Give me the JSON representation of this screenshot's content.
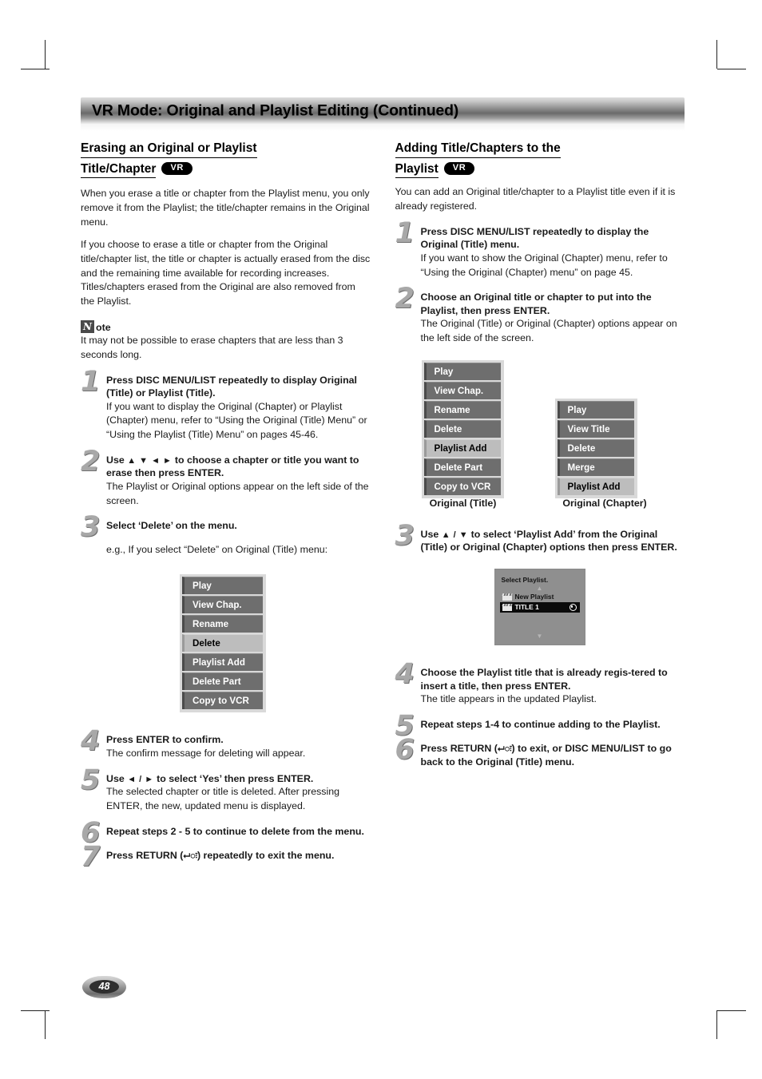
{
  "header": {
    "title": "VR Mode: Original and Playlist Editing (Continued)"
  },
  "page_number": "48",
  "left_column": {
    "heading_line1": "Erasing an Original or Playlist",
    "heading_line2": "Title/Chapter",
    "badge": "VR",
    "intro_paragraph_1": "When you erase a title or chapter from the Playlist menu, you only remove it from the Playlist; the title/chapter remains in the Original menu.",
    "intro_paragraph_2": "If you choose to erase a title or chapter from the Original title/chapter list, the title or chapter is actually erased from the disc and the remaining time available for recording increases. Titles/chapters erased from the Original are also removed from the Playlist.",
    "note": {
      "icon_letter": "N",
      "label": "ote",
      "text": "It may not be possible to erase chapters that are less than 3 seconds long."
    },
    "steps": [
      {
        "number": "1",
        "title": "Press DISC MENU/LIST repeatedly to display Original (Title) or Playlist (Title).",
        "desc": "If you want to display the Original (Chapter) or Playlist (Chapter) menu, refer to “Using the Original (Title) Menu” or “Using the Playlist (Title) Menu” on pages 45-46."
      },
      {
        "number": "2",
        "title_prefix": "Use ",
        "title_arrows": "▲ ▼ ◄ ►",
        "title_suffix": " to choose a chapter or title you want to erase then press ENTER.",
        "desc": "The Playlist or Original options appear on the left side of the screen."
      },
      {
        "number": "3",
        "title": "Select ‘Delete’ on the menu.",
        "desc": "e.g., If you select “Delete” on Original (Title) menu:"
      },
      {
        "number": "4",
        "title": "Press ENTER to confirm.",
        "desc": "The confirm message for deleting will appear."
      },
      {
        "number": "5",
        "title_prefix": "Use ",
        "title_arrows": "◄ / ►",
        "title_suffix": " to select ‘Yes’ then press ENTER.",
        "desc": "The selected chapter or title is deleted. After pressing ENTER, the new, updated menu is displayed."
      },
      {
        "number": "6",
        "title": "Repeat steps 2 - 5 to continue to delete from the menu.",
        "desc": ""
      },
      {
        "number": "7",
        "title_prefix": "Press RETURN (",
        "title_symbol": "⮠ः",
        "title_suffix": ") repeatedly to exit the menu.",
        "desc": ""
      }
    ],
    "osd_menu": {
      "name": "original-title-menu",
      "items": [
        {
          "label": "Play",
          "selected": false
        },
        {
          "label": "View Chap.",
          "selected": false
        },
        {
          "label": "Rename",
          "selected": false
        },
        {
          "label": "Delete",
          "selected": true
        },
        {
          "label": "Playlist Add",
          "selected": false
        },
        {
          "label": "Delete Part",
          "selected": false
        },
        {
          "label": "Copy to VCR",
          "selected": false
        }
      ]
    }
  },
  "right_column": {
    "heading_line1": "Adding Title/Chapters to the",
    "heading_line2": "Playlist",
    "badge": "VR",
    "intro_paragraph_1": "You can add an Original title/chapter to a Playlist title even if it is already registered.",
    "steps": [
      {
        "number": "1",
        "title": "Press DISC MENU/LIST repeatedly to display the Original (Title) menu.",
        "desc": "If you want to show the Original (Chapter) menu, refer to “Using the Original (Chapter) menu” on page 45."
      },
      {
        "number": "2",
        "title": "Choose an Original title or chapter to put into the Playlist, then press ENTER.",
        "desc": "The Original (Title) or Original (Chapter) options appear on the left side of the screen."
      },
      {
        "number": "3",
        "title_prefix": "Use ",
        "title_arrows": "▲ / ▼",
        "title_suffix": " to select ‘Playlist Add’ from the Original (Title) or Original (Chapter) options then press ENTER.",
        "desc": ""
      },
      {
        "number": "4",
        "title": "Choose the Playlist title that is already regis-tered to insert a title, then press ENTER.",
        "desc": "The title appears in the updated Playlist."
      },
      {
        "number": "5",
        "title": "Repeat steps 1-4 to continue adding to the Playlist.",
        "desc": ""
      },
      {
        "number": "6",
        "title_prefix": "Press RETURN (",
        "title_symbol": "⮠ः",
        "title_suffix": ") to exit, or DISC MENU/LIST to go back to the Original (Title) menu.",
        "desc": ""
      }
    ],
    "osd_menu_title": {
      "caption": "Original (Title)",
      "items": [
        {
          "label": "Play",
          "selected": false
        },
        {
          "label": "View Chap.",
          "selected": false
        },
        {
          "label": "Rename",
          "selected": false
        },
        {
          "label": "Delete",
          "selected": false
        },
        {
          "label": "Playlist Add",
          "selected": true
        },
        {
          "label": "Delete Part",
          "selected": false
        },
        {
          "label": "Copy to VCR",
          "selected": false
        }
      ]
    },
    "osd_menu_chapter": {
      "caption": "Original (Chapter)",
      "items": [
        {
          "label": "Play",
          "selected": false
        },
        {
          "label": "View Title",
          "selected": false
        },
        {
          "label": "Delete",
          "selected": false
        },
        {
          "label": "Merge",
          "selected": false
        },
        {
          "label": "Playlist Add",
          "selected": true
        }
      ]
    },
    "select_playlist_dialog": {
      "title": "Select Playlist.",
      "up_arrow": "▲",
      "down_arrow": "▼",
      "rows": [
        {
          "label": "New Playlist",
          "highlighted": false,
          "has_dot": false
        },
        {
          "label": "TITLE 1",
          "highlighted": true,
          "has_dot": true
        }
      ]
    }
  }
}
